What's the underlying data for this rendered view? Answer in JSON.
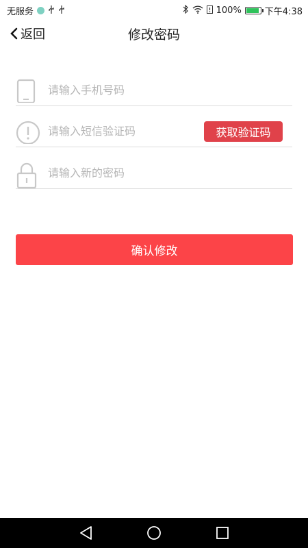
{
  "status_bar": {
    "carrier": "无服务",
    "battery": "100%",
    "battery_level": 1.0,
    "time": "下午4:38"
  },
  "nav": {
    "back_label": "返回",
    "title": "修改密码"
  },
  "form": {
    "phone_placeholder": "请输入手机号码",
    "sms_placeholder": "请输入短信验证码",
    "get_code_label": "获取验证码",
    "password_placeholder": "请输入新的密码"
  },
  "confirm_label": "确认修改",
  "colors": {
    "accent": "#fc4448",
    "code_button": "#e0424a",
    "icon_gray": "#c8c8c8",
    "divider": "#dcdcdc"
  },
  "icons": [
    "phone-icon",
    "info-icon",
    "lock-icon",
    "back-icon",
    "bluetooth-icon",
    "wifi-icon",
    "battery-icon",
    "triangle-back-icon",
    "circle-home-icon",
    "square-recent-icon"
  ]
}
